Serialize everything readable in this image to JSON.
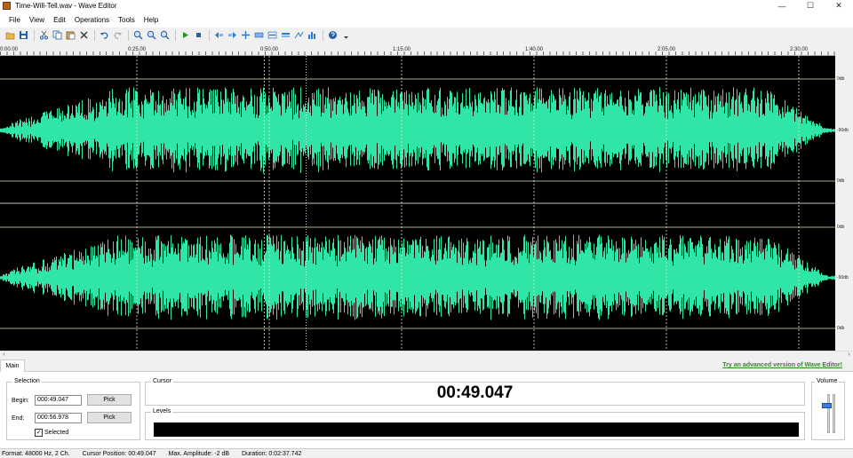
{
  "window": {
    "title": "Time-Will-Tell.wav - Wave Editor",
    "minimize_glyph": "—",
    "maximize_glyph": "☐",
    "close_glyph": "✕"
  },
  "menu": [
    "File",
    "View",
    "Edit",
    "Operations",
    "Tools",
    "Help"
  ],
  "toolbar": {
    "icons": [
      "open-icon",
      "save-icon",
      "cut-icon",
      "copy-icon",
      "paste-icon",
      "delete-icon",
      "undo-icon",
      "redo-icon",
      "zoom-in-icon",
      "zoom-out-icon",
      "zoom-fit-icon",
      "play-icon",
      "stop-icon",
      "trim-left-icon",
      "trim-right-icon",
      "split-icon",
      "select-all-icon",
      "normalize-icon",
      "amplify-icon",
      "fade-icon",
      "effects-icon",
      "help-icon"
    ]
  },
  "ruler": {
    "labels": [
      "0:00.00",
      "0:25.00",
      "0:50.00",
      "1:15.00",
      "1:40.00",
      "2:05.00",
      "2:30.00"
    ]
  },
  "channels": {
    "db_labels": [
      "0db",
      "-90db",
      "0db",
      "0db",
      "-90db",
      "0db"
    ]
  },
  "waveform": {
    "color": "#2fe6a6",
    "grid_color": "#e6e6b4",
    "duration_seconds": 157.742,
    "cursor_seconds": 49.047,
    "selection_end_seconds": 56.978
  },
  "bottom": {
    "tab_main": "Main",
    "promo_link": "Try an advanced version of Wave Editor!",
    "selection": {
      "title": "Selection",
      "begin_label": "Begin:",
      "begin_value": "000:49.047",
      "end_label": "End:",
      "end_value": "000:56.978",
      "pick_label": "Pick",
      "selected_label": "Selected",
      "selected_checked": true
    },
    "cursor": {
      "title": "Cursor",
      "time": "00:49.047"
    },
    "levels": {
      "title": "Levels"
    },
    "volume": {
      "title": "Volume",
      "level": 0.7
    }
  },
  "status": {
    "format": "Format: 48000 Hz, 2 Ch.",
    "cursor_position": "Cursor Position: 00:49.047",
    "max_amplitude": "Max. Amplitude: -2 dB",
    "duration": "Duration: 0:02:37.742"
  }
}
